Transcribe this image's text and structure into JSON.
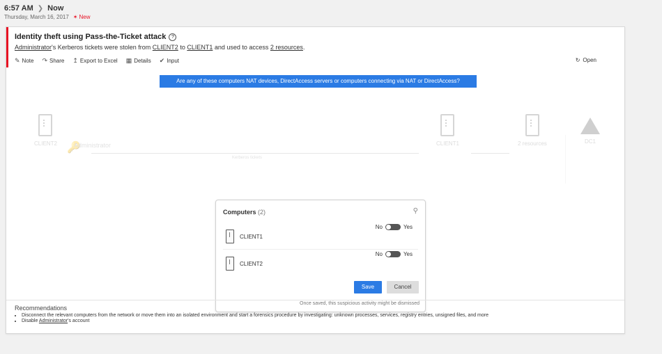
{
  "header": {
    "time": "6:57 AM",
    "crumb": "Now",
    "date": "Thursday, March 16, 2017",
    "new_label": "New"
  },
  "alert": {
    "title": "Identity theft using Pass-the-Ticket attack",
    "desc_user": "Administrator",
    "desc_1": "'s Kerberos tickets were stolen from ",
    "desc_from": "CLIENT2",
    "desc_2": " to ",
    "desc_to": "CLIENT1",
    "desc_3": " and used to access ",
    "desc_res": "2 resources",
    "desc_4": ".",
    "accent_color": "#e81123"
  },
  "toolbar": {
    "note": "Note",
    "share": "Share",
    "export": "Export to Excel",
    "details": "Details",
    "input": "Input",
    "status": "Open"
  },
  "question": "Are any of these computers NAT devices, DirectAccess servers or computers connecting via NAT or DirectAccess?",
  "graph": {
    "source": "CLIENT2",
    "user": "Administrator",
    "edge_label": "Kerberos tickets",
    "target": "CLIENT1",
    "resources": "2 resources",
    "dc": "DC1"
  },
  "popup": {
    "title": "Computers",
    "count": "(2)",
    "no": "No",
    "yes": "Yes",
    "rows": [
      {
        "name": "CLIENT1",
        "value": "No"
      },
      {
        "name": "CLIENT2",
        "value": "No"
      }
    ],
    "save": "Save",
    "cancel": "Cancel",
    "note": "Once saved, this suspicious activity might be dismissed"
  },
  "recommendations": {
    "title": "Recommendations",
    "item1": "Disconnect the relevant computers from the network or move them into an isolated environment and start a forensics procedure by investigating: unknown processes, services, registry entries, unsigned files, and more",
    "item2_pre": "Disable ",
    "item2_user": "Administrator",
    "item2_post": "'s account"
  },
  "colors": {
    "primary": "#2b7be4",
    "accent": "#e81123"
  }
}
